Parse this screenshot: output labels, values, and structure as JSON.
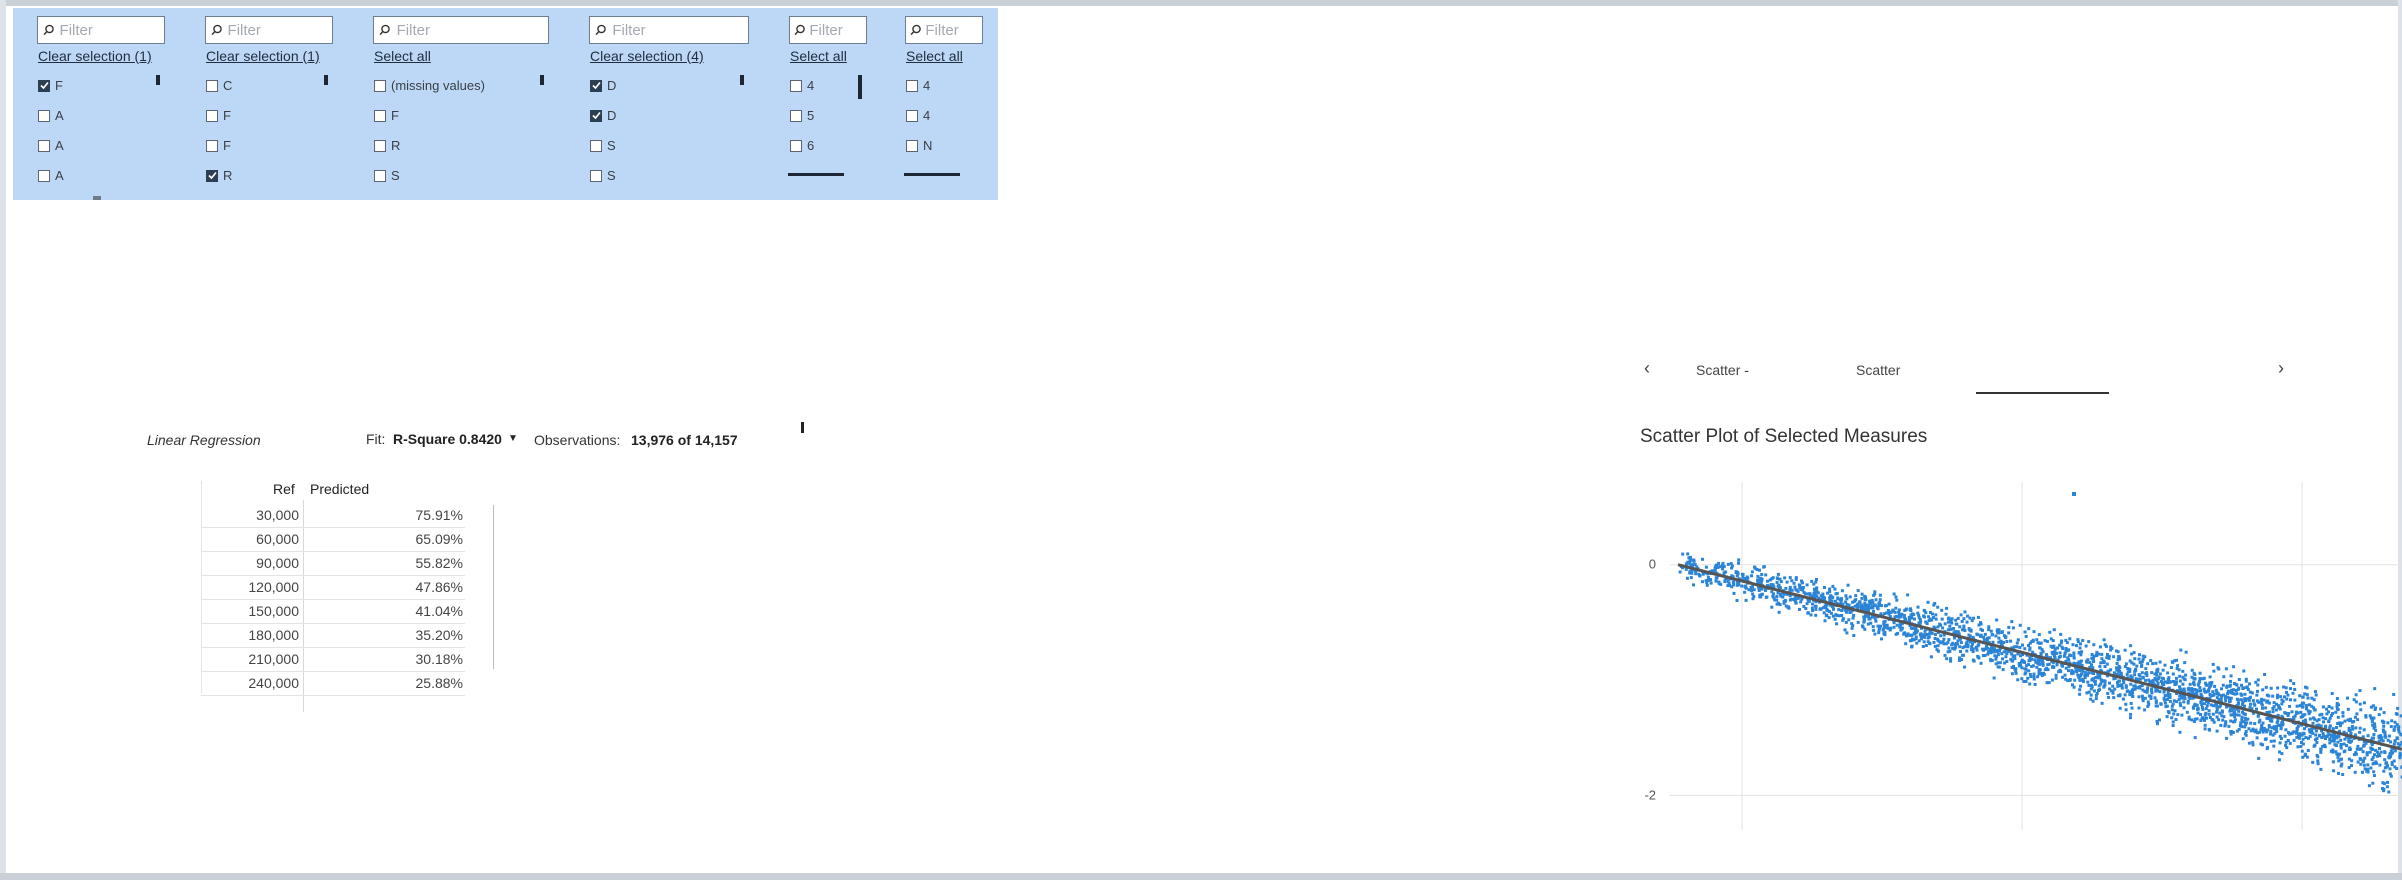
{
  "filters": [
    {
      "placeholder": "Filter",
      "link": "Clear selection (1)",
      "options": [
        {
          "label": "F",
          "checked": true
        },
        {
          "label": "A",
          "checked": false
        },
        {
          "label": "A",
          "checked": false
        },
        {
          "label": "A",
          "checked": false
        }
      ]
    },
    {
      "placeholder": "Filter",
      "link": "Clear selection (1)",
      "options": [
        {
          "label": "C",
          "checked": false
        },
        {
          "label": "F",
          "checked": false
        },
        {
          "label": "F",
          "checked": false
        },
        {
          "label": "R",
          "checked": true
        }
      ]
    },
    {
      "placeholder": "Filter",
      "link": "Select all",
      "options": [
        {
          "label": "(missing values)",
          "checked": false
        },
        {
          "label": "F",
          "checked": false
        },
        {
          "label": "R",
          "checked": false
        },
        {
          "label": "S",
          "checked": false
        }
      ]
    },
    {
      "placeholder": "Filter",
      "link": "Clear selection (4)",
      "options": [
        {
          "label": "D",
          "checked": true
        },
        {
          "label": "D",
          "checked": true
        },
        {
          "label": "S",
          "checked": false
        },
        {
          "label": "S",
          "checked": false
        }
      ]
    },
    {
      "placeholder": "Filter",
      "link": "Select all",
      "options": [
        {
          "label": "4",
          "checked": false
        },
        {
          "label": "5",
          "checked": false
        },
        {
          "label": "6",
          "checked": false
        }
      ]
    },
    {
      "placeholder": "Filter",
      "link": "Select all",
      "options": [
        {
          "label": "4",
          "checked": false
        },
        {
          "label": "4",
          "checked": false
        },
        {
          "label": "N",
          "checked": false
        }
      ]
    }
  ],
  "regression": {
    "title": "Linear Regression",
    "fit_label": "Fit:",
    "fit_value": "R-Square 0.8420",
    "fit_caret": "▼",
    "obs_label": "Observations:",
    "obs_value": "13,976 of 14,157",
    "table": {
      "headers": {
        "ref": "Ref",
        "predicted": "Predicted"
      },
      "rows": [
        {
          "ref": "30,000",
          "predicted": "75.91%"
        },
        {
          "ref": "60,000",
          "predicted": "65.09%"
        },
        {
          "ref": "90,000",
          "predicted": "55.82%"
        },
        {
          "ref": "120,000",
          "predicted": "47.86%"
        },
        {
          "ref": "150,000",
          "predicted": "41.04%"
        },
        {
          "ref": "180,000",
          "predicted": "35.20%"
        },
        {
          "ref": "210,000",
          "predicted": "30.18%"
        },
        {
          "ref": "240,000",
          "predicted": "25.88%"
        }
      ]
    }
  },
  "tabs": {
    "prev": "‹",
    "next": "›",
    "items": [
      "Scatter -",
      "Scatter"
    ]
  },
  "chart_data": {
    "type": "scatter",
    "title": "Scatter Plot of Selected Measures",
    "y_ticks": [
      "0",
      "-2"
    ],
    "ylim": [
      -2.3,
      0.7
    ],
    "grid": true,
    "trend": {
      "x0": 0,
      "y0": 0.0,
      "x1": 1,
      "y1": -1.6
    },
    "point_color": "#2b84d6",
    "trend_color": "#555555"
  }
}
